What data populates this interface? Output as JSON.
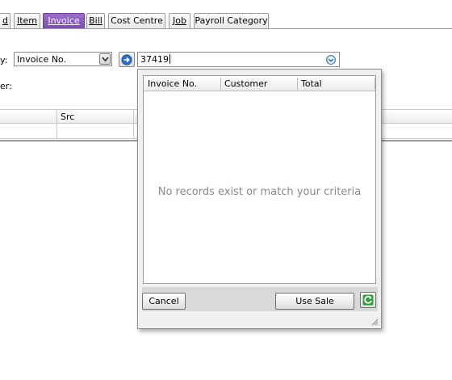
{
  "tabs": [
    {
      "label": "d",
      "active": false
    },
    {
      "label": "Item",
      "active": false
    },
    {
      "label": "Invoice",
      "active": true
    },
    {
      "label": "Bill",
      "active": false
    },
    {
      "label": "Cost Centre",
      "active": false
    },
    {
      "label": "Job",
      "active": false
    },
    {
      "label": "Payroll Category",
      "active": false
    }
  ],
  "search": {
    "by_label": "y:",
    "field_select_value": "Invoice No.",
    "query_value": "37419",
    "second_label": "er:"
  },
  "background_table": {
    "columns": [
      "",
      "Src"
    ]
  },
  "popup": {
    "columns": [
      "Invoice No.",
      "Customer",
      "Total"
    ],
    "empty_message": "No records exist or match your criteria",
    "cancel_label": "Cancel",
    "use_sale_label": "Use Sale"
  },
  "icons": {
    "go": "arrow-right-circle-icon",
    "dropdown": "chevron-down-circle-icon",
    "refresh": "refresh-icon"
  },
  "colors": {
    "active_tab": "#7a4bb0",
    "go_icon": "#2a6fc9",
    "refresh_icon": "#2e9e3a"
  }
}
